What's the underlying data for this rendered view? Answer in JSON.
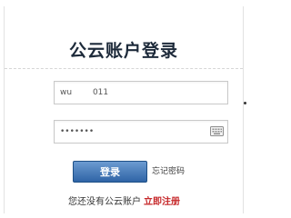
{
  "login": {
    "title": "公云账户登录",
    "username_value": "wu        011",
    "password_value": "•••••••",
    "login_button": "登录",
    "forgot_password": "忘记密码",
    "register_prompt": "您还没有公云账户",
    "register_link": "立即注册"
  },
  "icons": {
    "password_field": "keyboard-icon"
  },
  "colors": {
    "title": "#1d2a3a",
    "button": "#2f64a6",
    "register_link": "#c6282a"
  }
}
